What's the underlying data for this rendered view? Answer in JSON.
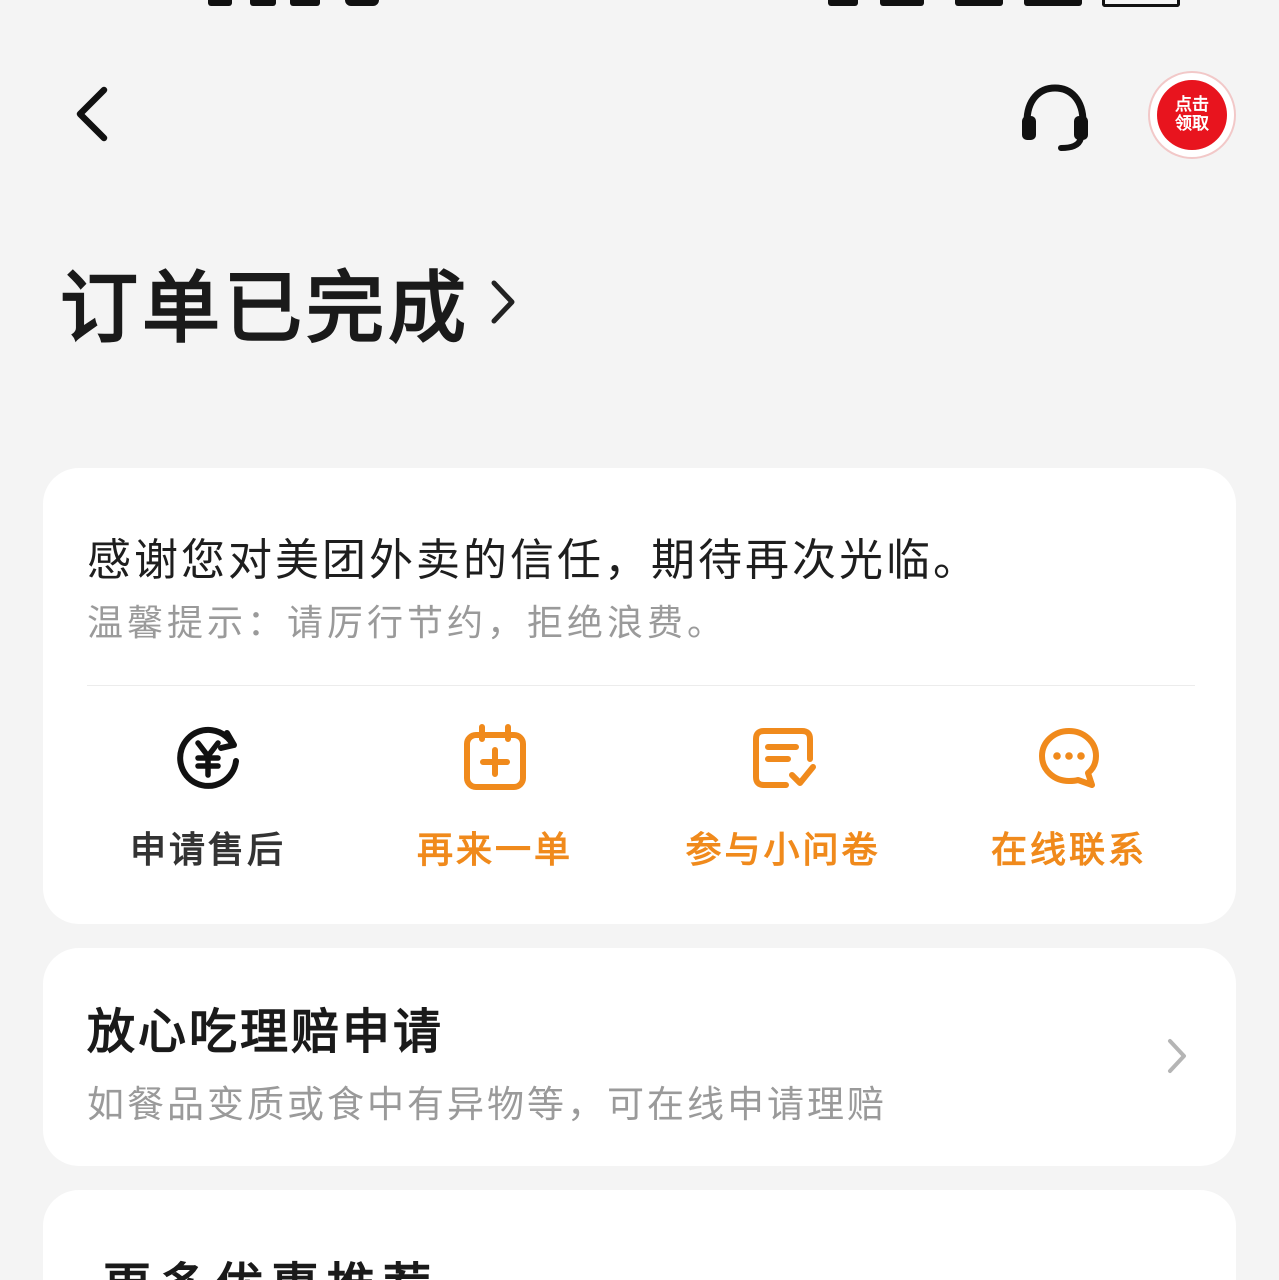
{
  "colors": {
    "background": "#f4f4f4",
    "card": "#ffffff",
    "accent_orange": "#f08a1c",
    "text_dark": "#1a1a1a",
    "text_gray": "#9a9a9a",
    "badge_red": "#e8141e"
  },
  "nav": {
    "back_icon": "chevron-left-icon",
    "support_icon": "headset-icon",
    "coupon_badge": {
      "line1": "点击",
      "line2": "领取"
    }
  },
  "header": {
    "title": "订单已完成"
  },
  "status_card": {
    "thanks": "感谢您对美团外卖的信任，期待再次光临。",
    "tip": "温馨提示：请厉行节约，拒绝浪费。",
    "actions": [
      {
        "label": "申请售后",
        "icon": "yuan-refund-icon",
        "color": "#333333"
      },
      {
        "label": "再来一单",
        "icon": "calendar-plus-icon",
        "color": "#f08a1c"
      },
      {
        "label": "参与小问卷",
        "icon": "survey-check-icon",
        "color": "#f08a1c"
      },
      {
        "label": "在线联系",
        "icon": "chat-bubble-icon",
        "color": "#f08a1c"
      }
    ]
  },
  "claim_card": {
    "title": "放心吃理赔申请",
    "description": "如餐品变质或食中有异物等，可在线申请理赔"
  },
  "more_card": {
    "title": "更多优惠推荐"
  }
}
